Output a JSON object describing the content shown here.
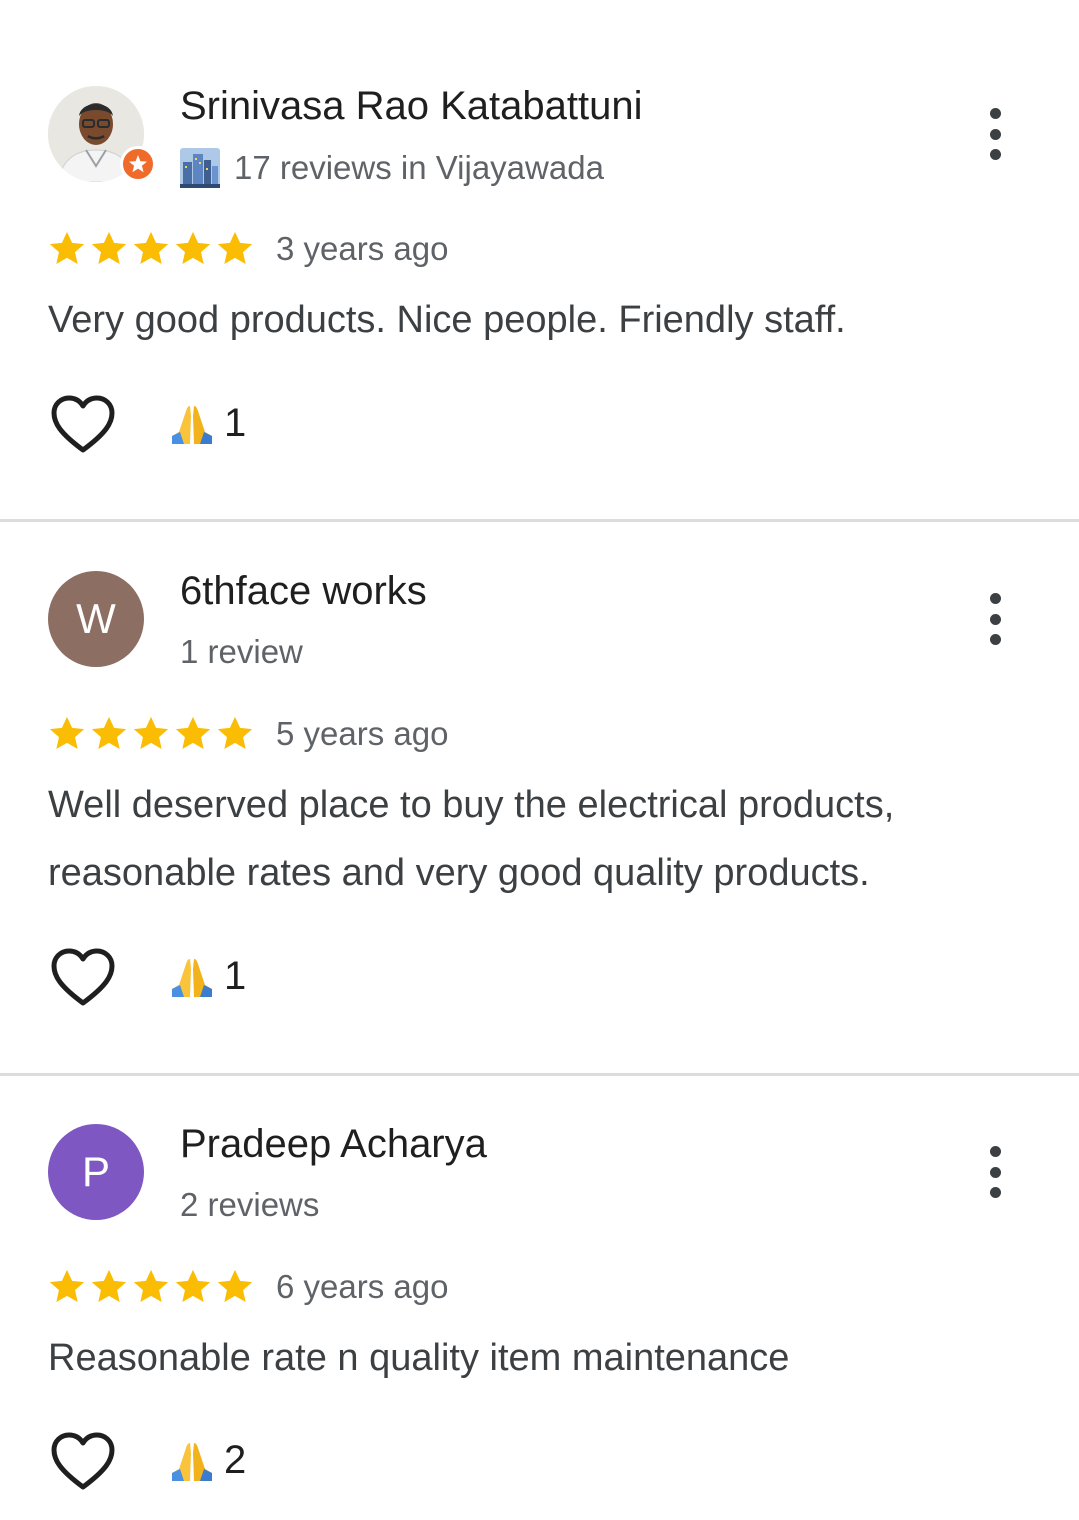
{
  "reviews": [
    {
      "author": "Srinivasa Rao Katabattuni",
      "subtitle": "17 reviews in Vijayawada",
      "is_local_guide": true,
      "avatar_type": "photo",
      "avatar_letter": "",
      "rating": 5,
      "time": "3 years ago",
      "text": "Very good products. Nice people. Friendly staff.",
      "reaction_count": "1"
    },
    {
      "author": "6thface works",
      "subtitle": "1 review",
      "is_local_guide": false,
      "avatar_type": "letter",
      "avatar_letter": "W",
      "avatar_color": "#8d6e63",
      "rating": 5,
      "time": "5 years ago",
      "text": "Well deserved place to buy the electrical products, reasonable rates and very good quality products.",
      "reaction_count": "1"
    },
    {
      "author": "Pradeep Acharya",
      "subtitle": "2 reviews",
      "is_local_guide": false,
      "avatar_type": "letter",
      "avatar_letter": "P",
      "avatar_color": "#7e57c2",
      "rating": 5,
      "time": "6 years ago",
      "text": "Reasonable rate n quality item maintenance",
      "reaction_count": "2"
    }
  ],
  "colors": {
    "star": "#fbbc04",
    "divider": "#dadce0",
    "local_guide_badge": "#f06a2a"
  },
  "icons": {
    "like": "heart-outline-icon",
    "reaction": "folded-hands-icon",
    "more": "more-vert-icon",
    "local_guide": "city-buildings-icon"
  }
}
